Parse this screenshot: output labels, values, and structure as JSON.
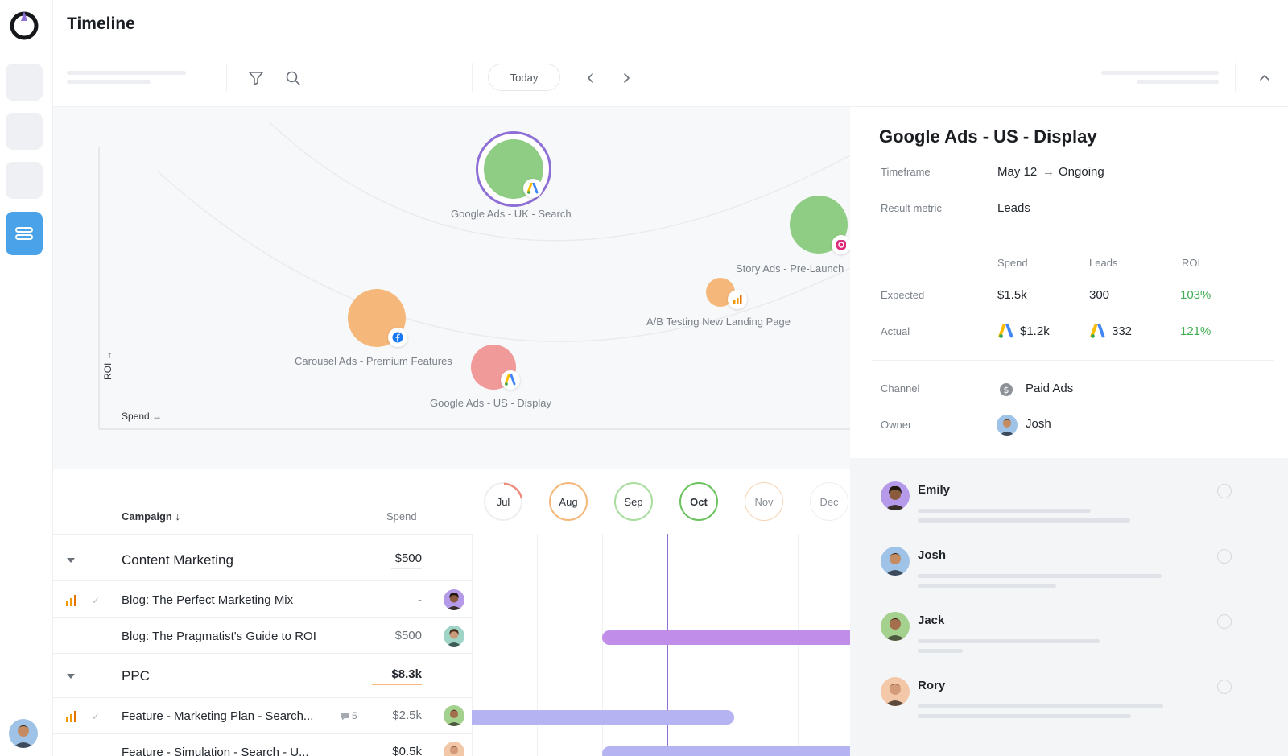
{
  "header": {
    "title": "Timeline"
  },
  "toolbar": {
    "today_label": "Today"
  },
  "chart_data": {
    "type": "scatter",
    "xlabel": "Spend →",
    "ylabel": "ROI →",
    "points": [
      {
        "label": "Google Ads - UK - Search",
        "color": "#8fcd84",
        "channel": "google-ads",
        "selected": true
      },
      {
        "label": "Story Ads - Pre-Launch",
        "color": "#8fcd84",
        "channel": "instagram"
      },
      {
        "label": "A/B Testing New Landing Page",
        "color": "#f5b87a",
        "channel": "analytics"
      },
      {
        "label": "Carousel Ads - Premium Features",
        "color": "#f5b87a",
        "channel": "facebook"
      },
      {
        "label": "Google Ads - US - Display",
        "color": "#f19a9a",
        "channel": "google-ads"
      }
    ]
  },
  "panel": {
    "title": "Google Ads - US - Display",
    "timeframe_label": "Timeframe",
    "timeframe_start": "May 12",
    "timeframe_arrow": "→",
    "timeframe_end": "Ongoing",
    "result_label": "Result metric",
    "result_value": "Leads",
    "col_spend": "Spend",
    "col_leads": "Leads",
    "col_roi": "ROI",
    "expected_label": "Expected",
    "expected_spend": "$1.5k",
    "expected_leads": "300",
    "expected_roi": "103%",
    "actual_label": "Actual",
    "actual_spend": "$1.2k",
    "actual_leads": "332",
    "actual_roi": "121%",
    "channel_label": "Channel",
    "channel_value": "Paid Ads",
    "owner_label": "Owner",
    "owner_value": "Josh"
  },
  "comments": [
    {
      "name": "Emily"
    },
    {
      "name": "Josh"
    },
    {
      "name": "Jack"
    },
    {
      "name": "Rory"
    }
  ],
  "table": {
    "col_campaign": "Campaign ↓",
    "col_spend": "Spend",
    "months": [
      "Jul",
      "Aug",
      "Sep",
      "Oct",
      "Nov",
      "Dec"
    ],
    "groups": [
      {
        "name": "Content Marketing",
        "amount": "$500",
        "rows": [
          {
            "name": "Blog: The Perfect Marketing Mix",
            "amount": "-"
          },
          {
            "name": "Blog: The Pragmatist's Guide to ROI",
            "amount": "$500"
          }
        ]
      },
      {
        "name": "PPC",
        "amount": "$8.3k",
        "rows": [
          {
            "name": "Feature - Marketing Plan - Search...",
            "comments": "5",
            "amount": "$2.5k"
          },
          {
            "name": "Feature - Simulation - Search - U...",
            "amount": "$0.5k"
          }
        ]
      }
    ]
  },
  "colors": {
    "accent": "#8e6fd6",
    "purple_bar": "#c08ee8",
    "lavender_bar": "#b6b3f3",
    "green": "#3fae52",
    "rail_active": "#4aa3e8"
  }
}
